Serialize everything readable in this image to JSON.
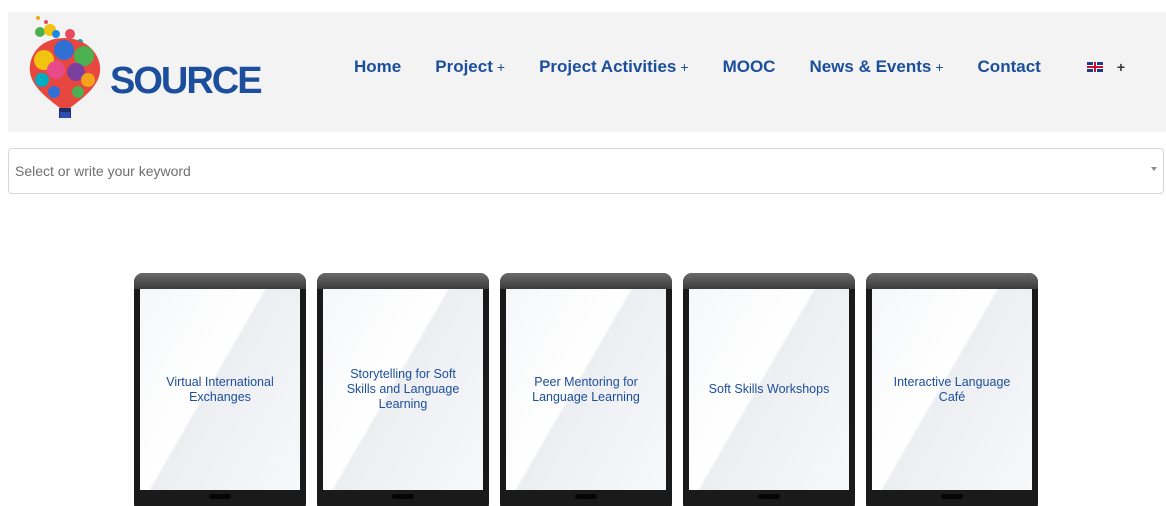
{
  "header": {
    "logo_text": "SOURCE",
    "nav": [
      {
        "label": "Home",
        "has_submenu": false
      },
      {
        "label": "Project",
        "has_submenu": true
      },
      {
        "label": "Project Activities",
        "has_submenu": true
      },
      {
        "label": "MOOC",
        "has_submenu": false
      },
      {
        "label": "News & Events",
        "has_submenu": true
      },
      {
        "label": "Contact",
        "has_submenu": false
      }
    ],
    "plus_symbol": "+",
    "language_flag_icon": "uk-flag-icon",
    "language_plus": "+"
  },
  "search": {
    "placeholder": "Select or write your keyword"
  },
  "tablets": [
    {
      "label": "Virtual International Exchanges"
    },
    {
      "label": "Storytelling for Soft Skills and Language Learning"
    },
    {
      "label": "Peer Mentoring for Language Learning"
    },
    {
      "label": "Soft Skills Workshops"
    },
    {
      "label": "Interactive Language Café"
    }
  ],
  "colors": {
    "brand_blue": "#1b4e9c",
    "header_bg": "#f3f3f3"
  }
}
